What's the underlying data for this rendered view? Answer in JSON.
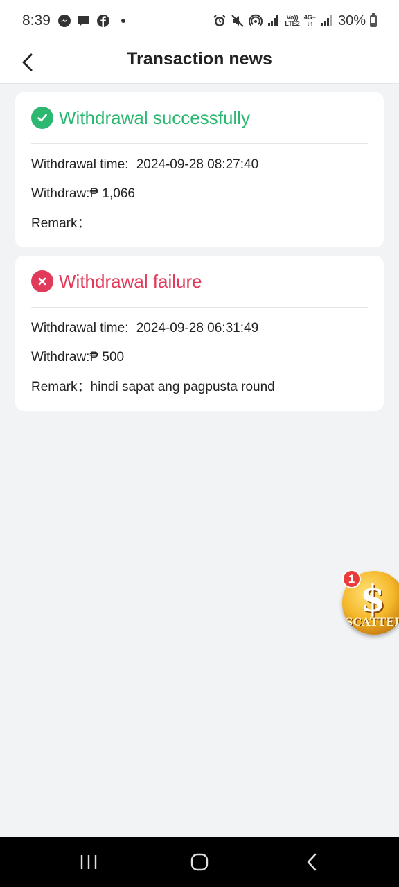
{
  "status_bar": {
    "time": "8:39",
    "network_top": "Vo))",
    "network_bottom": "LTE2",
    "data_type": "4G+",
    "data_arrows": "↓↑",
    "battery": "30%"
  },
  "header": {
    "title": "Transaction news"
  },
  "records": [
    {
      "status": "Withdrawal successfully",
      "status_color": "#2db872",
      "icon": "check-circle-icon",
      "time_label": "Withdrawal time:",
      "time_value": "2024-09-28 08:27:40",
      "amount_label": "Withdraw:",
      "amount_value": "₱ 1,066",
      "remark_label": "Remark：",
      "remark_value": ""
    },
    {
      "status": "Withdrawal failure",
      "status_color": "#e23a5a",
      "icon": "x-circle-icon",
      "time_label": "Withdrawal time:",
      "time_value": "2024-09-28 06:31:49",
      "amount_label": "Withdraw:",
      "amount_value": "₱ 500",
      "remark_label": "Remark：",
      "remark_value": "hindi sapat ang pagpusta round"
    }
  ],
  "floating_button": {
    "badge": "1",
    "symbol": "$",
    "label": "SCATTER"
  },
  "colors": {
    "background": "#f2f3f5",
    "success": "#2db872",
    "failure": "#e23a5a"
  }
}
